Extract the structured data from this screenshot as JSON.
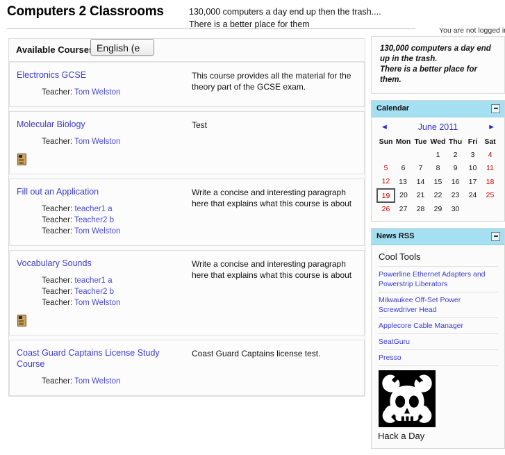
{
  "header": {
    "site_title": "Computers 2 Classrooms",
    "tagline_line1": "130,000 computers a day end up then the trash....",
    "tagline_line2": "There is a better place for them",
    "login_status": "You are not logged in"
  },
  "language_selector": {
    "selected": "English (e",
    "name": "language-dropdown"
  },
  "courses": {
    "heading": "Available Courses",
    "teacher_label": "Teacher:",
    "list": [
      {
        "name": "Electronics GCSE",
        "summary": "This course provides all the material for the theory part of the GCSE exam.",
        "teachers": [
          "Tom Welston"
        ],
        "has_icon": false
      },
      {
        "name": "Molecular Biology",
        "summary": "Test",
        "teachers": [
          "Tom Welston"
        ],
        "has_icon": true
      },
      {
        "name": "Fill out an Application",
        "summary": "Write a concise and interesting paragraph here that explains what this course is about",
        "teachers": [
          "teacher1 a",
          "Teacher2 b",
          "Tom Welston"
        ],
        "has_icon": false
      },
      {
        "name": "Vocabulary Sounds",
        "summary": "Write a concise and interesting paragraph here that explains what this course is about",
        "teachers": [
          "teacher1 a",
          "Teacher2 b",
          "Tom Welston"
        ],
        "has_icon": true
      },
      {
        "name": "Coast Guard Captains License Study Course",
        "summary": "Coast Guard Captains license test.",
        "teachers": [
          "Tom Welston"
        ],
        "has_icon": false
      }
    ]
  },
  "sidebar": {
    "promo": {
      "line1": "130,000 computers a day end",
      "line2": "up in the trash.",
      "line3": "There is a better place for",
      "line4": "them."
    },
    "calendar": {
      "title": "Calendar",
      "prev_arrow": "◄",
      "next_arrow": "►",
      "month_label": "June 2011",
      "weekdays": [
        "Sun",
        "Mon",
        "Tue",
        "Wed",
        "Thu",
        "Fri",
        "Sat"
      ],
      "weeks": [
        [
          "",
          "",
          "",
          "1",
          "2",
          "3",
          "4"
        ],
        [
          "5",
          "6",
          "7",
          "8",
          "9",
          "10",
          "11"
        ],
        [
          "12",
          "13",
          "14",
          "15",
          "16",
          "17",
          "18"
        ],
        [
          "19",
          "20",
          "21",
          "22",
          "23",
          "24",
          "25"
        ],
        [
          "26",
          "27",
          "28",
          "29",
          "30",
          "",
          ""
        ]
      ],
      "today": "19",
      "weekend_color": "#cc0000"
    },
    "news_rss": {
      "title": "News RSS",
      "feed_title": "Cool Tools",
      "items": [
        "Powerline Ethernet Adapters and Powerstrip Liberators",
        "Milwaukee Off-Set Power Screwdriver Head",
        "Applecore Cable Manager",
        "SeatGuru",
        "Presso"
      ],
      "logo_alt": "skull-and-wrenches-logo",
      "footer_text": "Hack a Day"
    }
  },
  "colors": {
    "block_header": "#a5dff2",
    "link": "#3a3ad0",
    "weekend": "#cc0000"
  }
}
